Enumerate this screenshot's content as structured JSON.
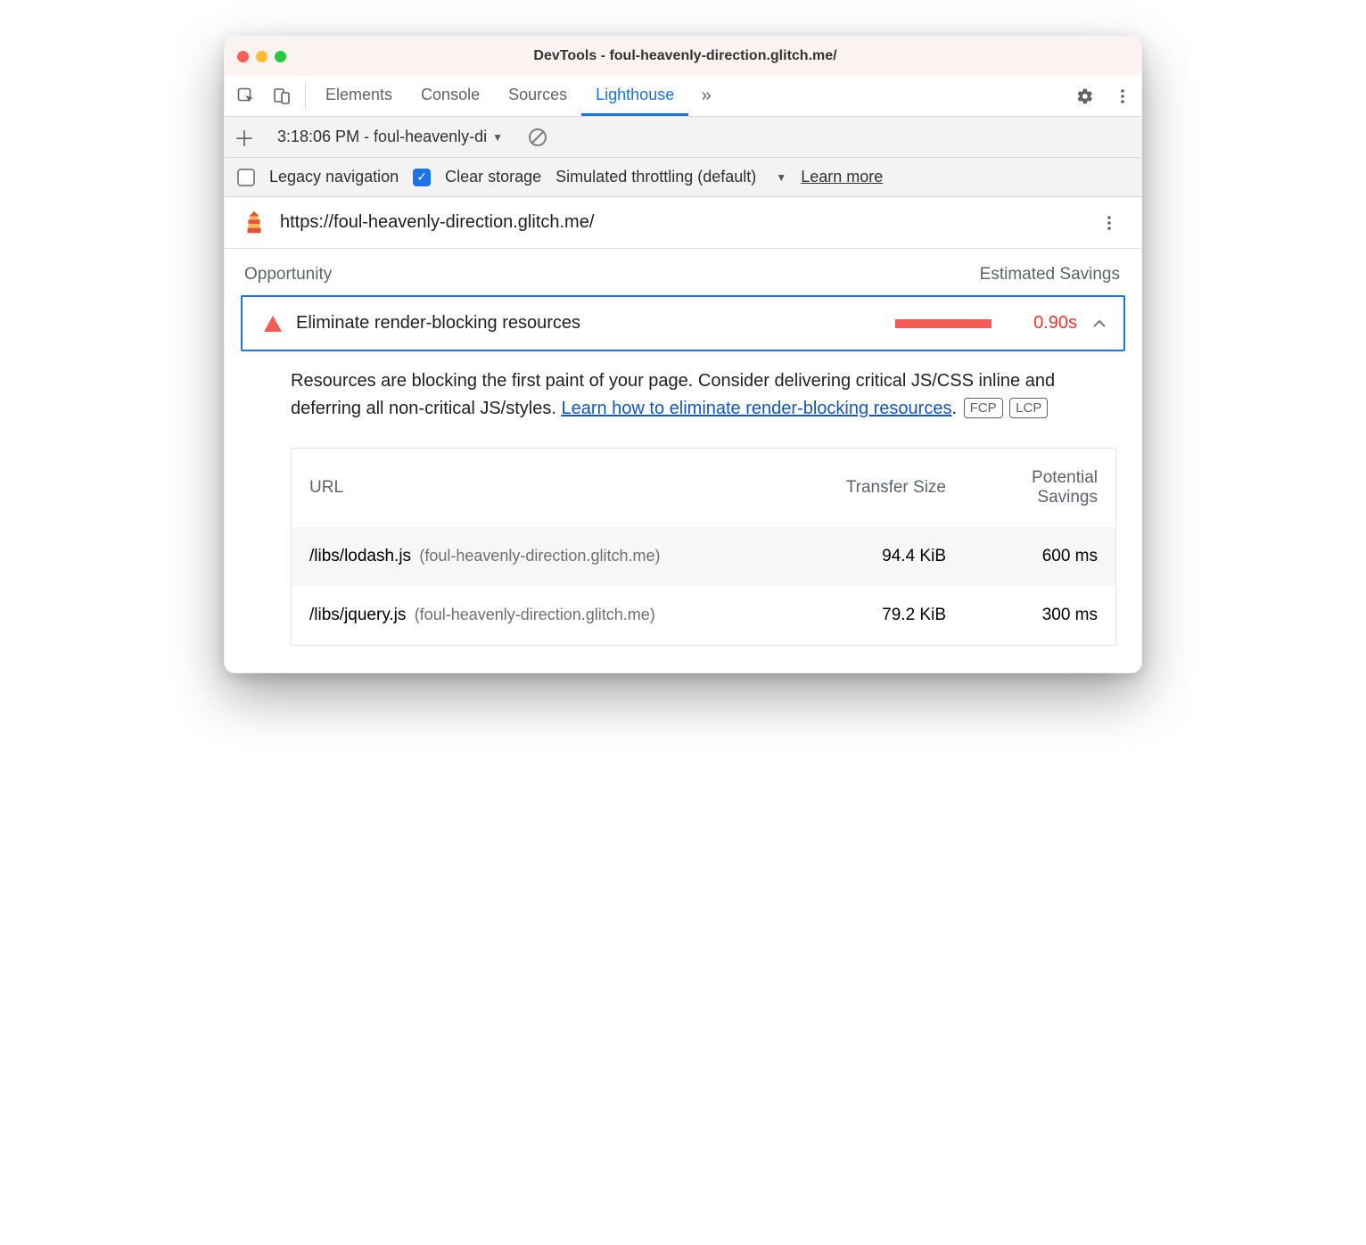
{
  "window": {
    "title": "DevTools - foul-heavenly-direction.glitch.me/"
  },
  "tabs": {
    "items": [
      "Elements",
      "Console",
      "Sources",
      "Lighthouse"
    ],
    "active": 3
  },
  "subtoolbar": {
    "report_label": "3:18:06 PM - foul-heavenly-di"
  },
  "options": {
    "legacy_label": "Legacy navigation",
    "legacy_checked": false,
    "clear_label": "Clear storage",
    "clear_checked": true,
    "throttling_label": "Simulated throttling (default)",
    "learn_label": "Learn more"
  },
  "urlrow": {
    "url": "https://foul-heavenly-direction.glitch.me/"
  },
  "section": {
    "left": "Opportunity",
    "right": "Estimated Savings"
  },
  "audit": {
    "title": "Eliminate render-blocking resources",
    "savings": "0.90s",
    "description_pre": "Resources are blocking the first paint of your page. Consider delivering critical JS/CSS inline and deferring all non-critical JS/styles. ",
    "learn_link": "Learn how to eliminate render-blocking resources",
    "period": ".",
    "metric1": "FCP",
    "metric2": "LCP"
  },
  "table": {
    "headers": {
      "url": "URL",
      "size": "Transfer Size",
      "savings": "Potential Savings"
    },
    "rows": [
      {
        "path": "/libs/lodash.js",
        "host": "(foul-heavenly-direction.glitch.me)",
        "size": "94.4 KiB",
        "savings": "600 ms"
      },
      {
        "path": "/libs/jquery.js",
        "host": "(foul-heavenly-direction.glitch.me)",
        "size": "79.2 KiB",
        "savings": "300 ms"
      }
    ]
  }
}
